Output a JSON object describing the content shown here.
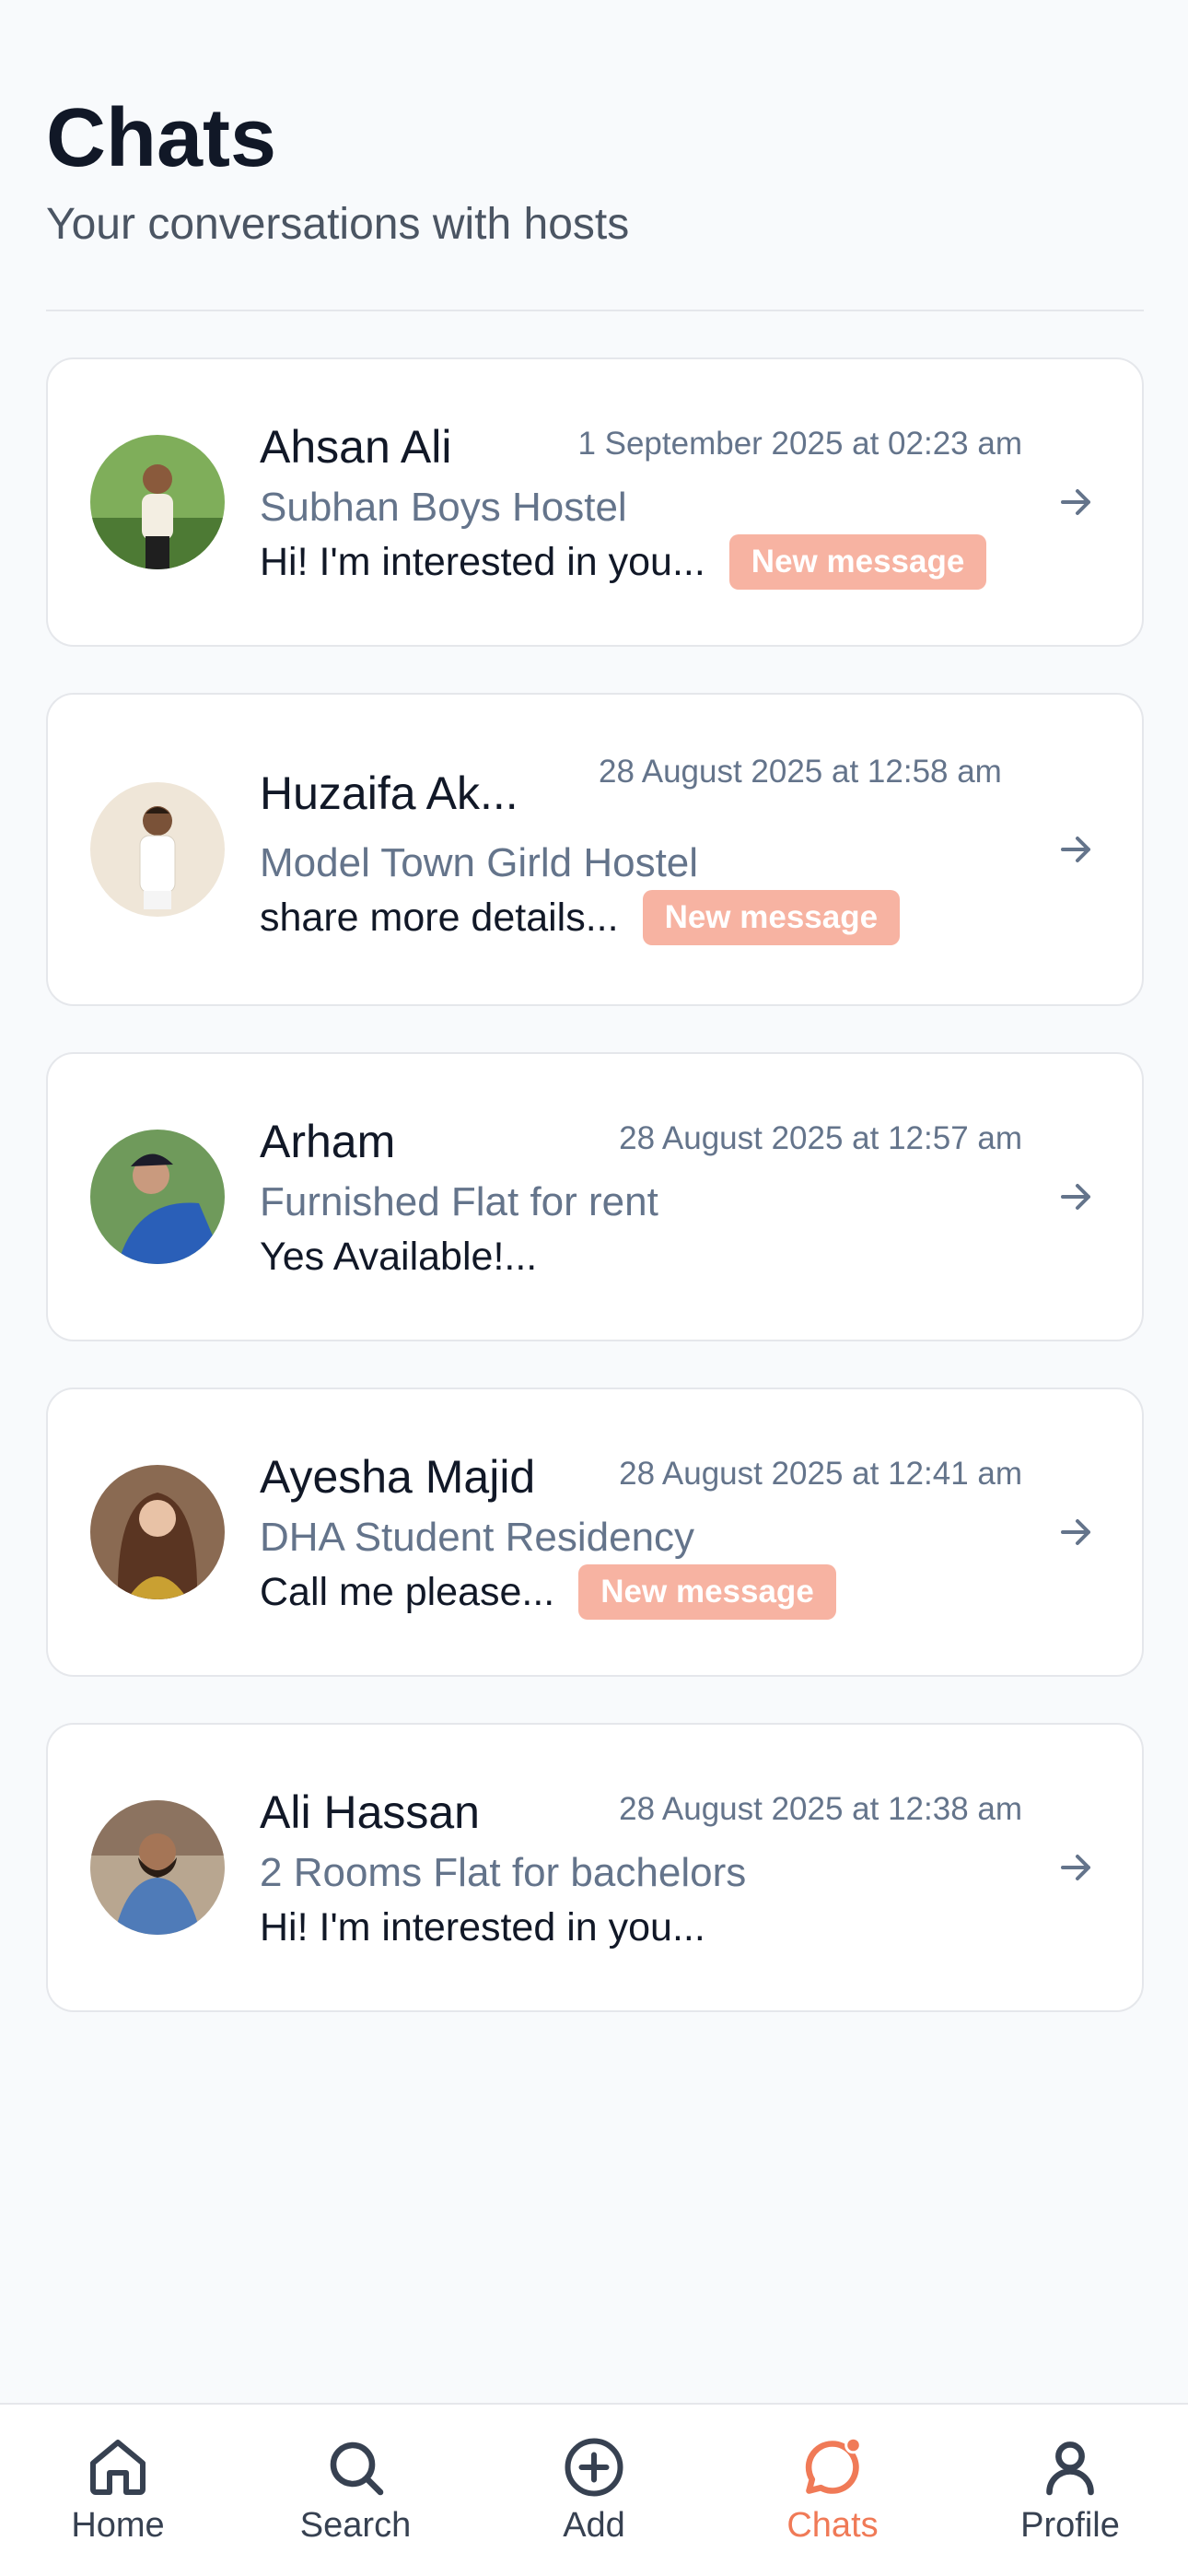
{
  "header": {
    "title": "Chats",
    "subtitle": "Your conversations with hosts"
  },
  "chats": [
    {
      "name": "Ahsan Ali",
      "time": "1 September 2025 at 02:23 am",
      "listing": "Subhan Boys Hostel",
      "message": "Hi! I'm interested in you...",
      "badge": "New message"
    },
    {
      "name": "Huzaifa Ak...",
      "time": "28 August 2025 at 12:58 am",
      "listing": "Model Town Girld Hostel",
      "message": "share more details...",
      "badge": "New message"
    },
    {
      "name": "Arham",
      "time": "28 August 2025 at 12:57 am",
      "listing": "Furnished Flat for rent",
      "message": "Yes Available!...",
      "badge": ""
    },
    {
      "name": "Ayesha Majid",
      "time": "28 August 2025 at 12:41 am",
      "listing": "DHA Student Residency",
      "message": "Call me please...",
      "badge": "New message"
    },
    {
      "name": "Ali Hassan",
      "time": "28 August 2025 at 12:38 am",
      "listing": "2 Rooms Flat for bachelors",
      "message": "Hi! I'm interested in you...",
      "badge": ""
    }
  ],
  "nav": {
    "items": [
      {
        "label": "Home",
        "icon": "home-icon"
      },
      {
        "label": "Search",
        "icon": "search-icon"
      },
      {
        "label": "Add",
        "icon": "add-circle-icon"
      },
      {
        "label": "Chats",
        "icon": "chat-bubble-icon",
        "active": true
      },
      {
        "label": "Profile",
        "icon": "user-icon"
      }
    ]
  },
  "colors": {
    "accent": "#f07a57",
    "badge_bg": "#f7b3a2",
    "muted_text": "#64748b",
    "background": "#f8fafc"
  }
}
